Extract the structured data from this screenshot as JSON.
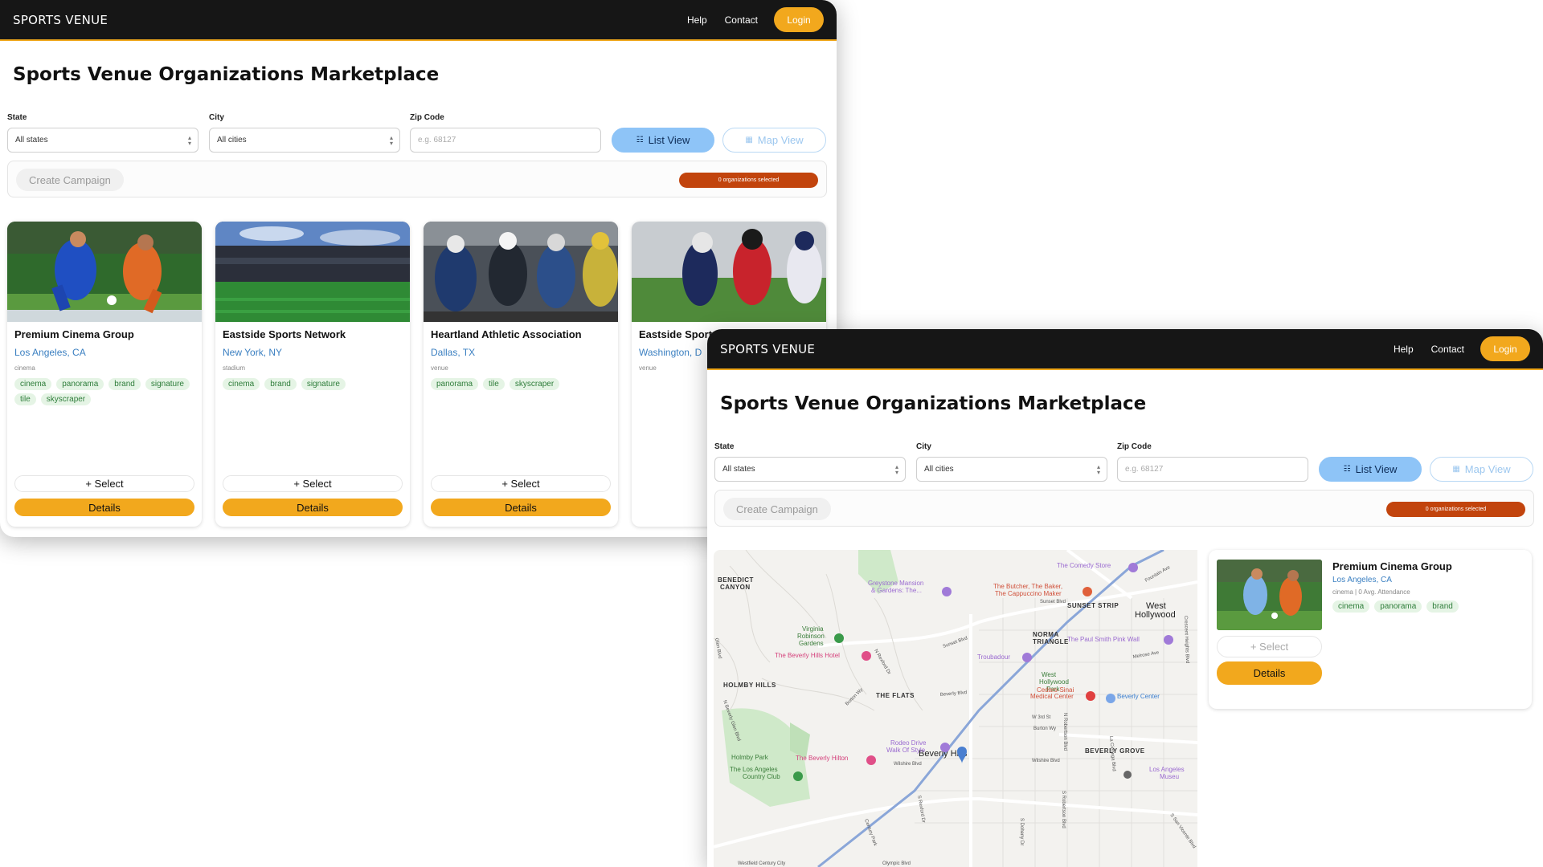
{
  "app": {
    "brand": "SPORTS VENUE",
    "nav": {
      "help": "Help",
      "contact": "Contact",
      "login": "Login"
    },
    "page_title": "Sports Venue Organizations Marketplace"
  },
  "filters": {
    "state_label": "State",
    "state_value": "All states",
    "city_label": "City",
    "city_value": "All cities",
    "zip_label": "Zip Code",
    "zip_placeholder": "e.g. 68127",
    "list_view": "List View",
    "map_view": "Map View"
  },
  "campaign": {
    "button": "Create Campaign",
    "selected": "0 organizations selected"
  },
  "colors": {
    "accent": "#f2a81d",
    "topbar": "#161616",
    "badge": "#c2440d",
    "link": "#3a7fc1",
    "tag_bg": "#e5f4e5",
    "tag_text": "#2e7d3a",
    "view_active": "#8ec4f7"
  },
  "cards": [
    {
      "name": "Premium Cinema Group",
      "location": "Los Angeles, CA",
      "type": "cinema",
      "tags": [
        "cinema",
        "panorama",
        "brand",
        "signature",
        "tile",
        "skyscraper"
      ],
      "select": "+ Select",
      "details": "Details"
    },
    {
      "name": "Eastside Sports Network",
      "location": "New York, NY",
      "type": "stadium",
      "tags": [
        "cinema",
        "brand",
        "signature"
      ],
      "select": "+ Select",
      "details": "Details"
    },
    {
      "name": "Heartland Athletic Association",
      "location": "Dallas, TX",
      "type": "venue",
      "tags": [
        "panorama",
        "tile",
        "skyscraper"
      ],
      "select": "+ Select",
      "details": "Details"
    },
    {
      "name": "Eastside Sport",
      "location": "Washington, D",
      "type": "venue",
      "tags": [],
      "select": "",
      "details": ""
    }
  ],
  "map_view": {
    "labels": {
      "benedict": "BENEDICT",
      "canyon": "CANYON",
      "holmby_hills": "HOLMBY HILLS",
      "the_flats": "THE FLATS",
      "beverly_hills": "Beverly Hills",
      "beverly_grove": "BEVERLY GROVE",
      "sunset_strip": "SUNSET STRIP",
      "west_hollywood_1": "West",
      "west_hollywood_2": "Hollywood",
      "norma_1": "NORMA",
      "norma_2": "TRIANGLE",
      "holmby_park": "Holmby Park",
      "la_country_club_1": "The Los Angeles",
      "la_country_club_2": "Country Club",
      "virginia_1": "Virginia",
      "virginia_2": "Robinson",
      "virginia_3": "Gardens",
      "comedy_store": "The Comedy Store",
      "greystone_1": "Greystone Mansion",
      "greystone_2": "& Gardens: The...",
      "butcher_1": "The Butcher, The Baker,",
      "butcher_2": "The Cappuccino Maker",
      "beverly_hills_hotel": "The Beverly Hills Hotel",
      "paul_smith": "The Paul Smith Pink Wall",
      "troubadour": "Troubadour",
      "whp_1": "West",
      "whp_2": "Hollywood",
      "whp_3": "Park",
      "cedars_1": "Cedars-Sinai",
      "cedars_2": "Medical Center",
      "beverly_center": "Beverly Center",
      "rodeo_1": "Rodeo Drive",
      "rodeo_2": "Walk Of Style",
      "beverly_hilton": "The Beverly Hilton",
      "lacma_1": "Los Angeles",
      "lacma_2": "Museu",
      "sunset_blvd": "Sunset Blvd",
      "fountain_ave": "Fountain Ave",
      "melrose_ave": "Melrose Ave",
      "beverly_blvd": "Beverly Blvd",
      "w_3rd_st": "W 3rd St",
      "burton_wy": "Burton Wy",
      "wilshire_blvd": "Wilshire Blvd",
      "olympic_blvd": "Olympic Blvd",
      "westfield": "Westfield Century City",
      "n_rexford": "N Rexford Dr",
      "n_robertson": "N Robertson Blvd",
      "la_cienega": "La Cienega Blvd",
      "crescent_heights": "Crescent Heights Blvd",
      "s_rexford": "S Rexford Dr",
      "s_doheny": "S Doheny Dr",
      "s_robertson": "S Robertson Blvd",
      "century_park": "Century Park",
      "beverly_glen": "N Beverly Glen Blvd",
      "s_san_vicente": "S San Vicente Blvd",
      "sunset_blvd2": "Sunset Blvd",
      "burton_wy2": "Burton Wy",
      "glen_blvd": "Glen Blvd"
    },
    "side_card": {
      "name": "Premium Cinema Group",
      "location": "Los Angeles, CA",
      "meta": "cinema | 0 Avg. Attendance",
      "tags": [
        "cinema",
        "panorama",
        "brand"
      ],
      "select": "+ Select",
      "details": "Details"
    }
  }
}
